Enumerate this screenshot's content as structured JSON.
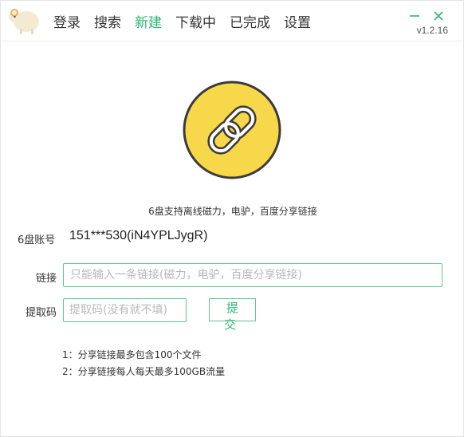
{
  "header": {
    "logo_icon": "sheep-logo-icon",
    "nav": [
      {
        "label": "登录",
        "active": false
      },
      {
        "label": "搜索",
        "active": false
      },
      {
        "label": "新建",
        "active": true
      },
      {
        "label": "下载中",
        "active": false
      },
      {
        "label": "已完成",
        "active": false
      },
      {
        "label": "设置",
        "active": false
      }
    ],
    "controls": {
      "minimize_icon": "minimize-icon",
      "close_icon": "close-icon"
    },
    "version": "v1.2.16"
  },
  "main": {
    "badge_icon": "chain-link-icon",
    "tagline": "6盘支持离线磁力，电驴，百度分享链接",
    "account": {
      "label": "6盘账号",
      "value": "151***530(iN4YPLJygR)"
    },
    "link": {
      "label": "链接",
      "placeholder": "只能输入一条链接(磁力，电驴，百度分享链接)",
      "value": ""
    },
    "code": {
      "label": "提取码",
      "placeholder": "提取码(没有就不填)",
      "value": ""
    },
    "submit_label": "提 交",
    "notes": [
      "1：分享链接最多包含100个文件",
      "2：分享链接每人每天最多100GB流量"
    ]
  },
  "colors": {
    "accent": "#2bb673",
    "border_accent": "#5ec98f",
    "badge_fill": "#f7d84a",
    "badge_stroke": "#3b3b3b"
  }
}
